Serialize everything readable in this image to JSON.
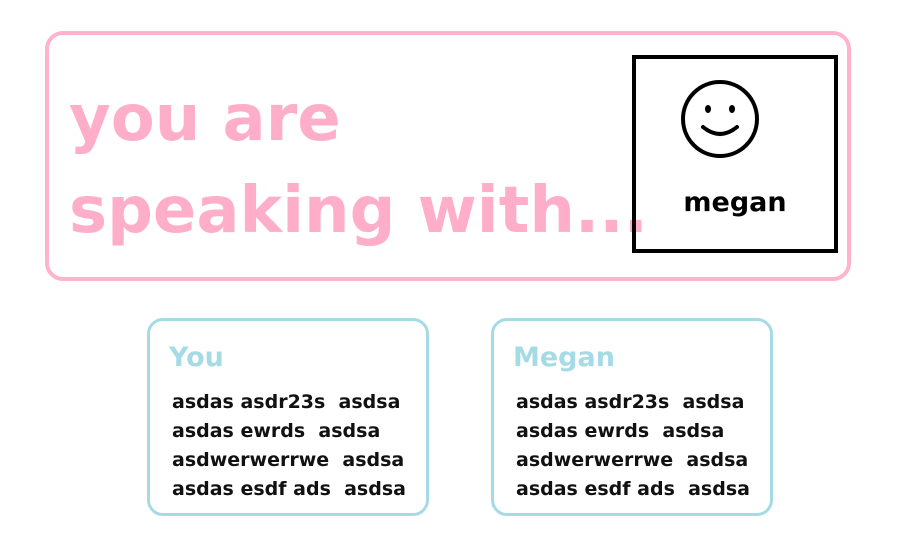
{
  "header": {
    "headline_line1": "you are",
    "headline_line2": "speaking with...",
    "accent_color": "#ffaec9"
  },
  "contact": {
    "avatar_icon": "smiley-face-icon",
    "name": "megan"
  },
  "chats": {
    "you": {
      "title": "You",
      "lines": [
        "asdas asdr23s  asdsa",
        "asdas ewrds  asdsa",
        "asdwerwerrwe  asdsa",
        "asdas esdf ads  asdsa"
      ]
    },
    "megan": {
      "title": "Megan",
      "lines": [
        "asdas asdr23s  asdsa",
        "asdas ewrds  asdsa",
        "asdwerwerrwe  asdsa",
        "asdas esdf ads  asdsa"
      ]
    },
    "title_color": "#a6dbe6"
  }
}
